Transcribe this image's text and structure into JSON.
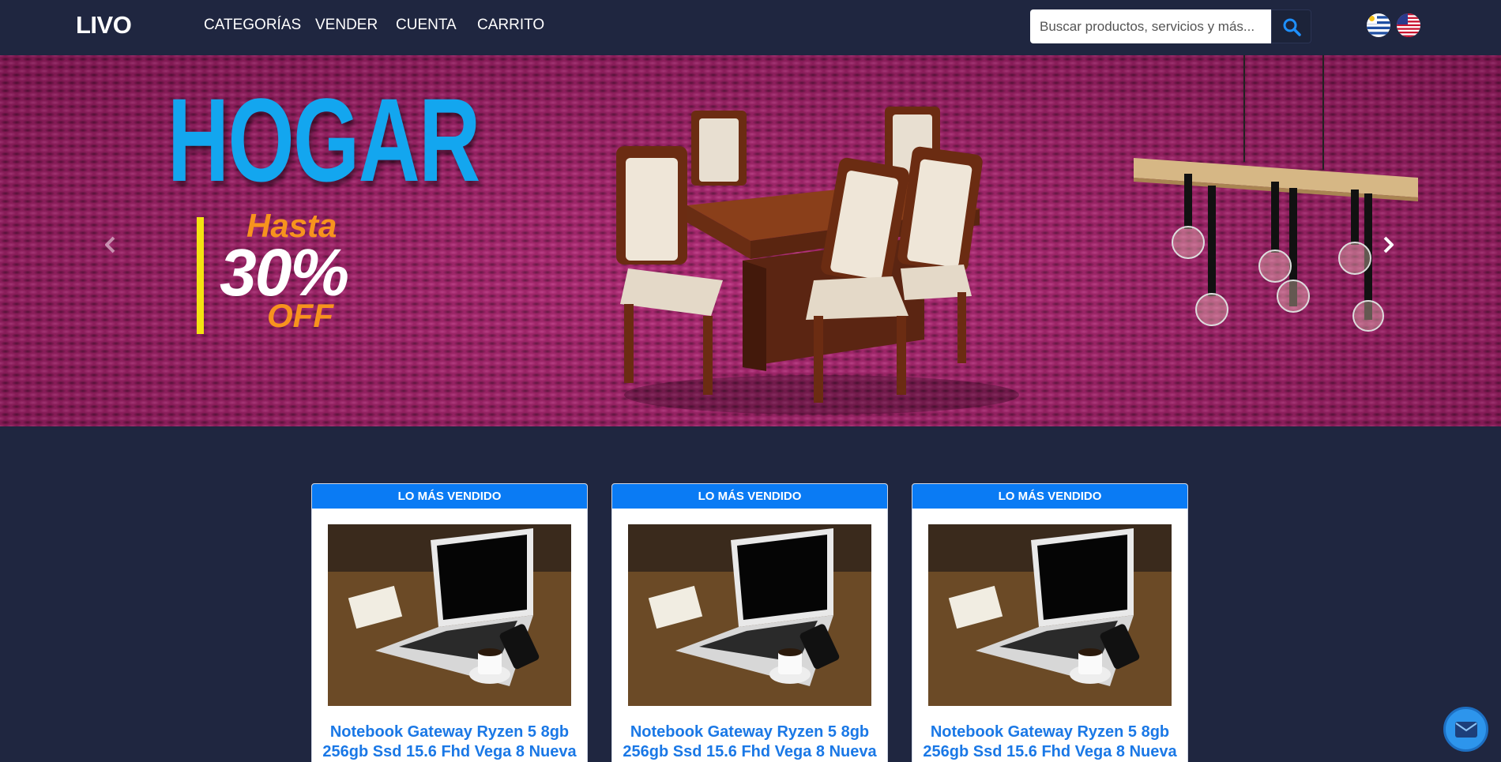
{
  "navbar": {
    "brand": "LIVO",
    "links": [
      {
        "label": "CATEGORÍAS"
      },
      {
        "label": "VENDER"
      },
      {
        "label": "CUENTA"
      },
      {
        "label": "CARRITO"
      }
    ],
    "search_placeholder": "Buscar productos, servicios y más...",
    "search_icon": "search-icon",
    "languages": [
      "uruguay-flag-icon",
      "usa-flag-icon"
    ]
  },
  "carousel": {
    "title": "HOGAR",
    "promo_hasta": "Hasta",
    "promo_percent": "30%",
    "promo_off": "OFF",
    "prev_icon": "chevron-left-icon",
    "next_icon": "chevron-right-icon"
  },
  "products": [
    {
      "badge": "LO MÁS VENDIDO",
      "title": "Notebook Gateway Ryzen 5 8gb 256gb Ssd 15.6 Fhd Vega 8 Nueva"
    },
    {
      "badge": "LO MÁS VENDIDO",
      "title": "Notebook Gateway Ryzen 5 8gb 256gb Ssd 15.6 Fhd Vega 8 Nueva"
    },
    {
      "badge": "LO MÁS VENDIDO",
      "title": "Notebook Gateway Ryzen 5 8gb 256gb Ssd 15.6 Fhd Vega 8 Nueva"
    }
  ],
  "chat": {
    "icon": "envelope-icon"
  },
  "colors": {
    "background": "#1f2640",
    "accent": "#0a7bf4",
    "hero_bg": "#a51f6a",
    "hero_title": "#13a6ef",
    "promo_orange": "#f7931e"
  }
}
